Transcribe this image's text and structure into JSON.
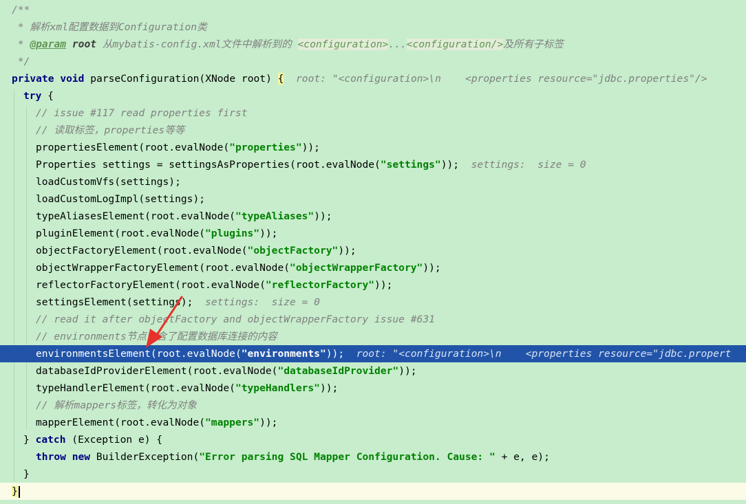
{
  "lines": {
    "l1": "/**",
    "l2_prefix": " * ",
    "l2_text": "解析xml配置数据到Configuration类",
    "l3_prefix": " * ",
    "l3_tag": "@param",
    "l3_param": "root",
    "l3_text1": " 从mybatis-config.xml文件中解析到的 ",
    "l3_box1": "<configuration>",
    "l3_dots": "...",
    "l3_box2": "<configuration/>",
    "l3_text2": "及所有子标签",
    "l4": " */",
    "l5_kw1": "private",
    "l5_kw2": "void",
    "l5_code": "parseConfiguration(XNode root) ",
    "l5_brace": "{",
    "l5_hint": "root: \"<configuration>\\n    <properties resource=\"jdbc.properties\"/>",
    "l6_kw": "try",
    "l6_code": " {",
    "l7": "// issue #117 read properties first",
    "l8": "// 读取标签，properties等等",
    "l9_a": "propertiesElement(root.evalNode(",
    "l9_s": "\"properties\"",
    "l9_b": "));",
    "l10_a": "Properties settings = settingsAsProperties(root.evalNode(",
    "l10_s": "\"settings\"",
    "l10_b": "));",
    "l10_hint": "settings:  size = 0",
    "l11": "loadCustomVfs(settings);",
    "l12": "loadCustomLogImpl(settings);",
    "l13_a": "typeAliasesElement(root.evalNode(",
    "l13_s": "\"typeAliases\"",
    "l13_b": "));",
    "l14_a": "pluginElement(root.evalNode(",
    "l14_s": "\"plugins\"",
    "l14_b": "));",
    "l15_a": "objectFactoryElement(root.evalNode(",
    "l15_s": "\"objectFactory\"",
    "l15_b": "));",
    "l16_a": "objectWrapperFactoryElement(root.evalNode(",
    "l16_s": "\"objectWrapperFactory\"",
    "l16_b": "));",
    "l17_a": "reflectorFactoryElement(root.evalNode(",
    "l17_s": "\"reflectorFactory\"",
    "l17_b": "));",
    "l18_a": "settingsElement(settings);",
    "l18_hint": "settings:  size = 0",
    "l19": "// read it after objectFactory and objectWrapperFactory issue #631",
    "l20": "// environments节点包含了配置数据库连接的内容",
    "l21_a": "environmentsElement(root.evalNode(",
    "l21_s": "\"environments\"",
    "l21_b": "));",
    "l21_hint": "root: \"<configuration>\\n    <properties resource=\"jdbc.propert",
    "l22_a": "databaseIdProviderElement(root.evalNode(",
    "l22_s": "\"databaseIdProvider\"",
    "l22_b": "));",
    "l23_a": "typeHandlerElement(root.evalNode(",
    "l23_s": "\"typeHandlers\"",
    "l23_b": "));",
    "l24": "// 解析mappers标签，转化为对象",
    "l25_a": "mapperElement(root.evalNode(",
    "l25_s": "\"mappers\"",
    "l25_b": "));",
    "l26_a": "} ",
    "l26_kw": "catch",
    "l26_b": " (Exception e) {",
    "l27_kw1": "throw",
    "l27_kw2": "new",
    "l27_a": " BuilderException(",
    "l27_s": "\"Error parsing SQL Mapper Configuration. Cause: \"",
    "l27_b": " + e, e);",
    "l28": "}",
    "l29": "}"
  },
  "colors": {
    "background": "#c7edcc",
    "current_line": "#2154a8",
    "keyword": "#000080",
    "string": "#008000",
    "comment": "#808080",
    "annotation_arrow": "#e8312a"
  },
  "icons": {
    "annotation": "red-arrow-icon"
  }
}
